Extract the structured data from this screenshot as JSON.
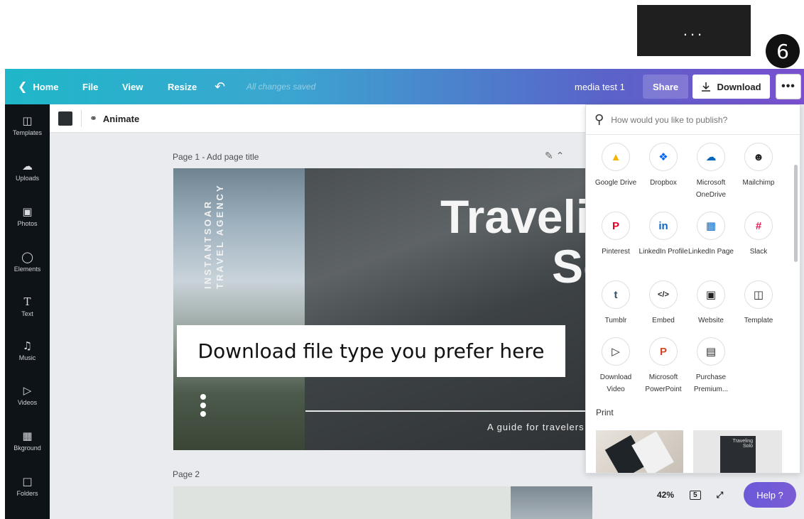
{
  "callout": {
    "dots": "...",
    "step_number": "6"
  },
  "topbar": {
    "home": "Home",
    "file": "File",
    "view": "View",
    "resize": "Resize",
    "saved_status": "All changes saved",
    "document_name": "media test 1",
    "share": "Share",
    "download": "Download",
    "more": "•••"
  },
  "sidebar": {
    "items": [
      {
        "label": "Templates",
        "icon": "templates-icon"
      },
      {
        "label": "Uploads",
        "icon": "uploads-icon"
      },
      {
        "label": "Photos",
        "icon": "photos-icon"
      },
      {
        "label": "Elements",
        "icon": "elements-icon"
      },
      {
        "label": "Text",
        "icon": "text-icon"
      },
      {
        "label": "Music",
        "icon": "music-icon"
      },
      {
        "label": "Videos",
        "icon": "videos-icon"
      },
      {
        "label": "Bkground",
        "icon": "background-icon"
      },
      {
        "label": "Folders",
        "icon": "folders-icon"
      }
    ]
  },
  "toolbar": {
    "animate": "Animate",
    "swatch_color": "#2b2e33"
  },
  "canvas": {
    "page1_label": "Page 1 - Add page title",
    "page2_label": "Page 2",
    "brand_line1": "INSTANTSOAR",
    "brand_line2": "TRAVEL AGENCY",
    "title_line1": "Traveli",
    "title_line2": "So",
    "subtitle": "A guide for travelers"
  },
  "annotation": {
    "text": "Download file type you prefer here"
  },
  "publish_panel": {
    "search_placeholder": "How would you like to publish?",
    "options": [
      {
        "label": "Google Drive",
        "icon": "google-drive-icon"
      },
      {
        "label": "Dropbox",
        "icon": "dropbox-icon"
      },
      {
        "label": "Microsoft OneDrive",
        "icon": "onedrive-icon"
      },
      {
        "label": "Mailchimp",
        "icon": "mailchimp-icon"
      },
      {
        "label": "Pinterest",
        "icon": "pinterest-icon"
      },
      {
        "label": "LinkedIn Profile",
        "icon": "linkedin-icon"
      },
      {
        "label": "LinkedIn Page",
        "icon": "linkedin-page-icon"
      },
      {
        "label": "Slack",
        "icon": "slack-icon"
      },
      {
        "label": "Tumblr",
        "icon": "tumblr-icon"
      },
      {
        "label": "Embed",
        "icon": "embed-icon"
      },
      {
        "label": "Website",
        "icon": "website-icon"
      },
      {
        "label": "Template",
        "icon": "template-icon"
      },
      {
        "label": "Download Video",
        "icon": "download-video-icon"
      },
      {
        "label": "Microsoft PowerPoint",
        "icon": "powerpoint-icon"
      },
      {
        "label": "Purchase Premium...",
        "icon": "purchase-icon"
      }
    ],
    "print_label": "Print",
    "print_thumb_text": "Traveling Solo"
  },
  "footer": {
    "zoom": "42%",
    "page_count": "5",
    "help": "Help ?"
  }
}
